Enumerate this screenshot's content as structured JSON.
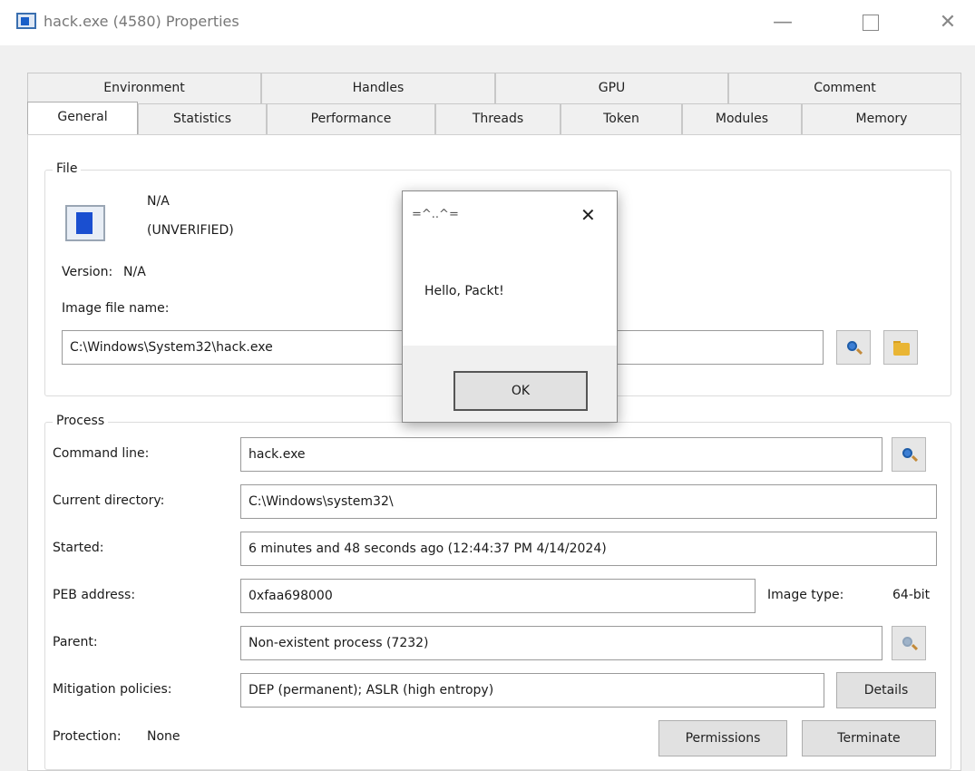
{
  "window": {
    "title": "hack.exe (4580) Properties",
    "minimize": "—",
    "close": "✕"
  },
  "tabs": {
    "row1": [
      "Environment",
      "Handles",
      "GPU",
      "Comment"
    ],
    "row2": [
      "General",
      "Statistics",
      "Performance",
      "Threads",
      "Token",
      "Modules",
      "Memory"
    ],
    "active": "General"
  },
  "file": {
    "group_label": "File",
    "company": "N/A",
    "verified": "(UNVERIFIED)",
    "version_label": "Version:",
    "version_value": "N/A",
    "image_file_label": "Image file name:",
    "image_file_value": "C:\\Windows\\System32\\hack.exe"
  },
  "process": {
    "group_label": "Process",
    "command_line_label": "Command line:",
    "command_line_value": "hack.exe",
    "current_dir_label": "Current directory:",
    "current_dir_value": "C:\\Windows\\system32\\",
    "started_label": "Started:",
    "started_value": "6 minutes and 48 seconds ago (12:44:37 PM 4/14/2024)",
    "peb_label": "PEB address:",
    "peb_value": "0xfaa698000",
    "image_type_label": "Image type:",
    "image_type_value": "64-bit",
    "parent_label": "Parent:",
    "parent_value": "Non-existent process (7232)",
    "mitigation_label": "Mitigation policies:",
    "mitigation_value": "DEP (permanent); ASLR (high entropy)",
    "details_button": "Details",
    "protection_label": "Protection:",
    "protection_value": "None",
    "permissions_button": "Permissions",
    "terminate_button": "Terminate"
  },
  "modal": {
    "title": "=^..^=",
    "message": "Hello, Packt!",
    "ok_button": "OK",
    "close": "✕"
  }
}
